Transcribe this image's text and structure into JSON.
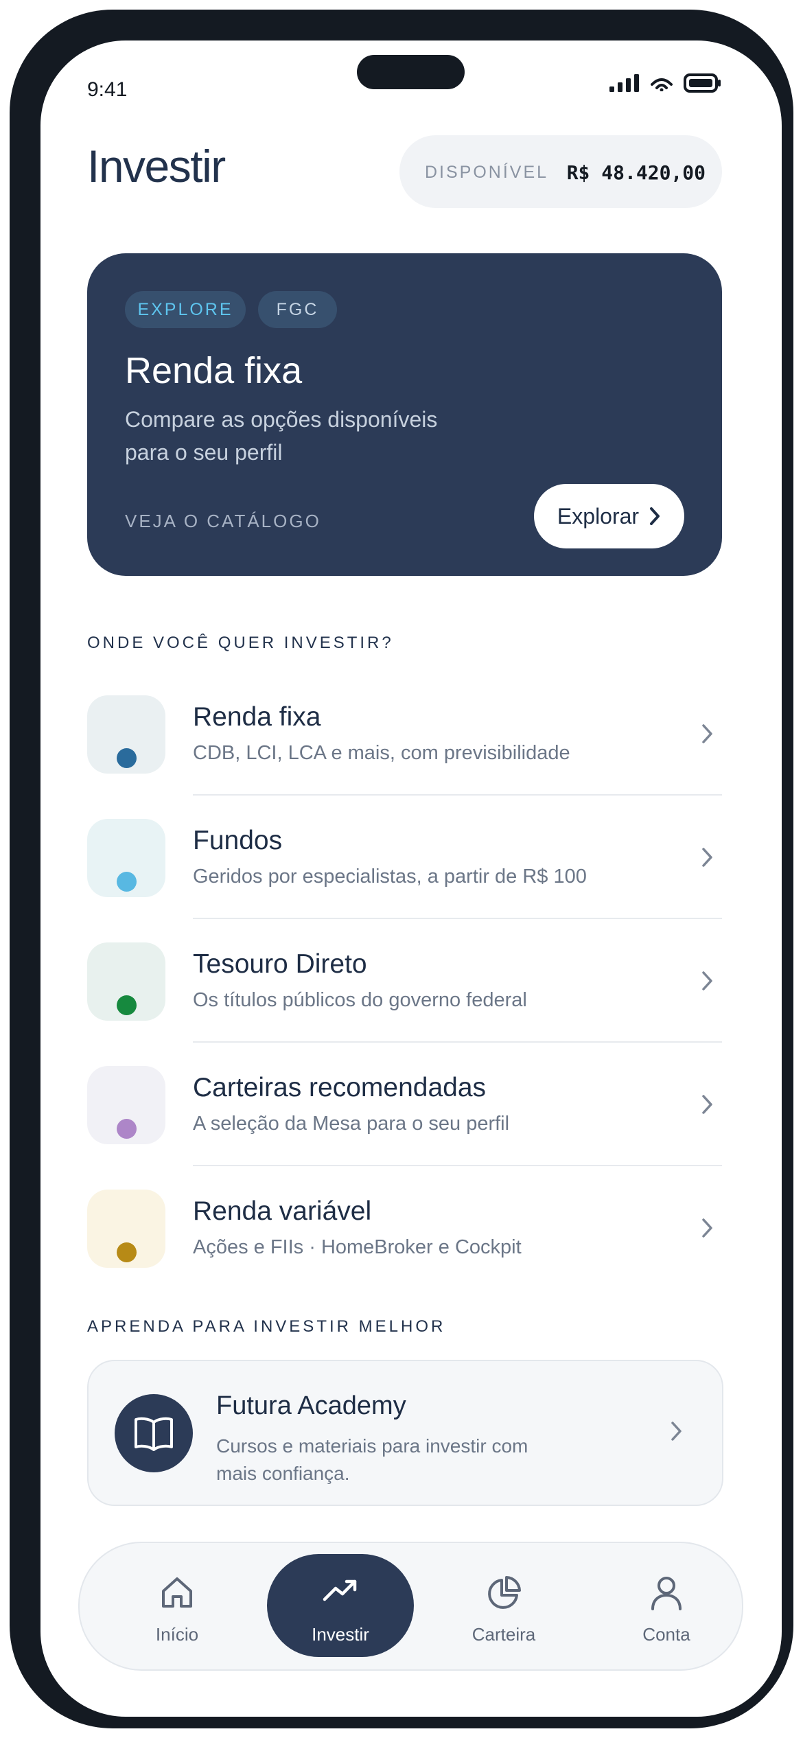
{
  "status_bar": {
    "time": "9:41"
  },
  "header": {
    "title": "Investir",
    "balance_label": "DISPONÍVEL",
    "balance_value": "R$ 48.420,00"
  },
  "hero": {
    "chips": [
      "EXPLORE",
      "FGC"
    ],
    "title": "Renda fixa",
    "description": "Compare as opções disponíveis para o seu perfil",
    "cta_text": "VEJA O CATÁLOGO",
    "button_label": "Explorar"
  },
  "invest_section": {
    "heading": "ONDE VOCÊ QUER INVESTIR?",
    "items": [
      {
        "title": "Renda fixa",
        "subtitle": "CDB, LCI, LCA e mais, com previsibilidade",
        "dot_color": "#2a6b9c",
        "bg_color": "#eaf0f2"
      },
      {
        "title": "Fundos",
        "subtitle": "Geridos por especialistas, a partir de R$ 100",
        "dot_color": "#58b8e2",
        "bg_color": "#e8f3f5"
      },
      {
        "title": "Tesouro Direto",
        "subtitle": "Os títulos públicos do governo federal",
        "dot_color": "#16893e",
        "bg_color": "#e8f1ee"
      },
      {
        "title": "Carteiras recomendadas",
        "subtitle": "A seleção da Mesa para o seu perfil",
        "dot_color": "#ad86c8",
        "bg_color": "#f1f1f6"
      },
      {
        "title": "Renda variável",
        "subtitle": "Ações e FIIs · HomeBroker e Cockpit",
        "dot_color": "#b78a16",
        "bg_color": "#faf4e3"
      }
    ]
  },
  "learn_section": {
    "heading": "APRENDA PARA INVESTIR MELHOR",
    "card_title": "Futura Academy",
    "card_subtitle": "Cursos e materiais para investir com mais confiança."
  },
  "bottom_nav": {
    "items": [
      {
        "label": "Início",
        "icon": "home-icon"
      },
      {
        "label": "Investir",
        "icon": "trending-up-icon",
        "active": true
      },
      {
        "label": "Carteira",
        "icon": "pie-chart-icon"
      },
      {
        "label": "Conta",
        "icon": "user-icon"
      }
    ]
  },
  "colors": {
    "navy": "#2c3b57",
    "accent_blue": "#5ec5ef",
    "text_dark": "#1e2d45",
    "text_muted": "#6b7687"
  }
}
